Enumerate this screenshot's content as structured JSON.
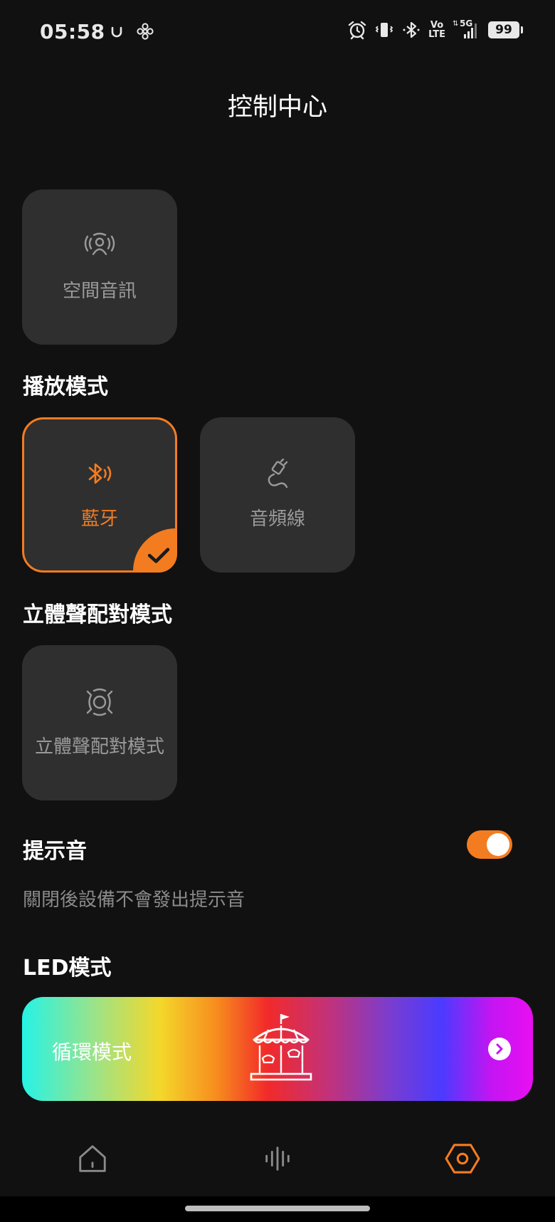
{
  "status_bar": {
    "time": "05:58",
    "left_icons": [
      "u-icon",
      "fan-icon"
    ],
    "right_icons": [
      "alarm-icon",
      "vibrate-icon",
      "bluetooth-icon",
      "volte-icon",
      "signal-5g-icon"
    ],
    "volte_top": "Vo",
    "volte_bottom": "LTE",
    "network": "5G",
    "battery": "99"
  },
  "header": {
    "title": "控制中心"
  },
  "spatial_audio": {
    "label": "空間音訊",
    "icon": "spatial-audio-icon"
  },
  "playback_mode": {
    "title": "播放模式",
    "options": [
      {
        "label": "藍牙",
        "icon": "bluetooth-sound-icon",
        "selected": true
      },
      {
        "label": "音頻線",
        "icon": "audio-cable-icon",
        "selected": false
      }
    ]
  },
  "stereo_pairing": {
    "title": "立體聲配對模式",
    "tile_label": "立體聲配對模式",
    "icon": "stereo-pair-icon"
  },
  "prompt_tone": {
    "title": "提示音",
    "enabled": true,
    "hint": "關閉後設備不會發出提示音"
  },
  "led_mode": {
    "title": "LED模式",
    "card_label": "循環模式",
    "icon": "carousel-icon"
  },
  "bottom_nav": [
    {
      "name": "home",
      "icon": "home-icon",
      "active": false
    },
    {
      "name": "equalizer",
      "icon": "sound-wave-icon",
      "active": false
    },
    {
      "name": "settings",
      "icon": "hexagon-settings-icon",
      "active": true
    }
  ],
  "colors": {
    "background": "#111111",
    "accent": "#f47c20",
    "tile": "#2f2f2f",
    "muted_text": "#9a9a9a"
  }
}
